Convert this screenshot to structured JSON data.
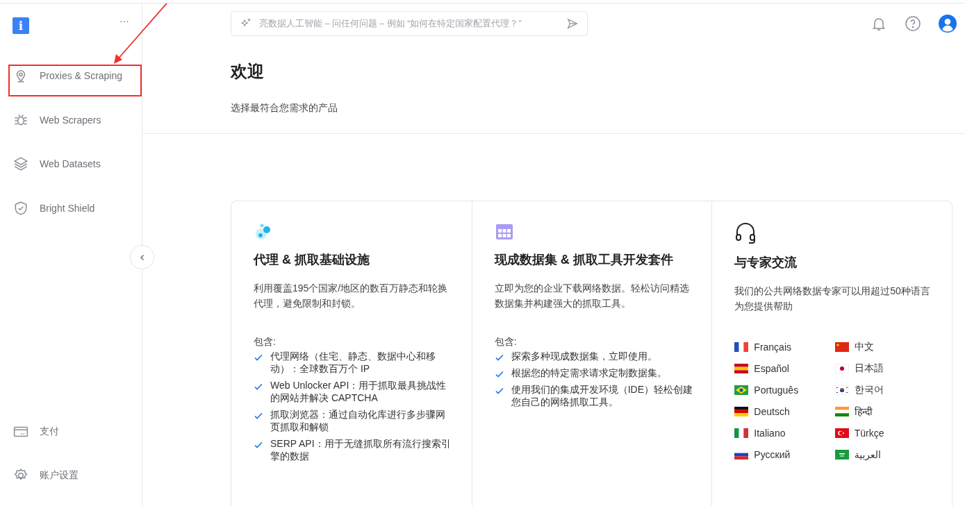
{
  "sidebar": {
    "more": "···",
    "logo": "i",
    "items": [
      {
        "label": "Proxies & Scraping"
      },
      {
        "label": "Web Scrapers"
      },
      {
        "label": "Web Datasets"
      },
      {
        "label": "Bright Shield"
      }
    ],
    "bottom_items": [
      {
        "label": "支付"
      },
      {
        "label": "账户设置"
      }
    ]
  },
  "search": {
    "placeholder": "亮数据人工智能 – 问任何问题 – 例如 “如何在特定国家配置代理？”"
  },
  "header": {
    "title": "欢迎",
    "subtitle": "选择最符合您需求的产品"
  },
  "cards": [
    {
      "title": "代理 & 抓取基础设施",
      "description": "利用覆盖195个国家/地区的数百万静态和轮换代理，避免限制和封锁。",
      "includes_label": "包含:",
      "features": [
        "代理网络（住宅、静态、数据中心和移动）：全球数百万个 IP",
        "Web Unlocker API：用于抓取最具挑战性的网站并解决 CAPTCHA",
        "抓取浏览器：通过自动化库进行多步骤网页抓取和解锁",
        "SERP API：用于无缝抓取所有流行搜索引擎的数据"
      ]
    },
    {
      "title": "现成数据集 & 抓取工具开发套件",
      "description": "立即为您的企业下载网络数据。轻松访问精选数据集并构建强大的抓取工具。",
      "includes_label": "包含:",
      "features": [
        "探索多种现成数据集，立即使用。",
        "根据您的特定需求请求定制数据集。",
        "使用我们的集成开发环境（IDE）轻松创建您自己的网络抓取工具。"
      ]
    },
    {
      "title": "与专家交流",
      "description": "我们的公共网络数据专家可以用超过50种语言为您提供帮助",
      "languages": [
        "Français",
        "中文",
        "Español",
        "日本語",
        "Português",
        "한국어",
        "Deutsch",
        "हिन्दी",
        "Italiano",
        "Türkçe",
        "Русский",
        "العربية"
      ]
    }
  ]
}
